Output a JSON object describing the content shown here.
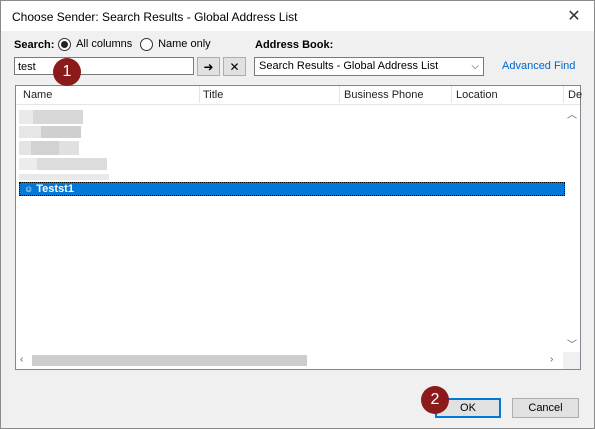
{
  "window": {
    "title": "Choose Sender: Search Results - Global Address List"
  },
  "search": {
    "label": "Search:",
    "option_all": "All columns",
    "option_name": "Name only",
    "value": "test",
    "go_glyph": "➜",
    "clear_glyph": "✕"
  },
  "address_book": {
    "label": "Address Book:",
    "selected": "Search Results - Global Address List"
  },
  "advanced_find": "Advanced Find",
  "list": {
    "columns": [
      "Name",
      "Title",
      "Business Phone",
      "Location",
      "De"
    ],
    "selected_name": "Testst1"
  },
  "buttons": {
    "ok": "OK",
    "cancel": "Cancel"
  },
  "callouts": {
    "one": "1",
    "two": "2"
  },
  "colors": {
    "selection": "#0078d7",
    "callout": "#8b1a1a",
    "link": "#0066cc"
  },
  "icons": {
    "close": "close-icon",
    "contact": "contact-icon",
    "dropdown": "chevron-down-icon"
  }
}
